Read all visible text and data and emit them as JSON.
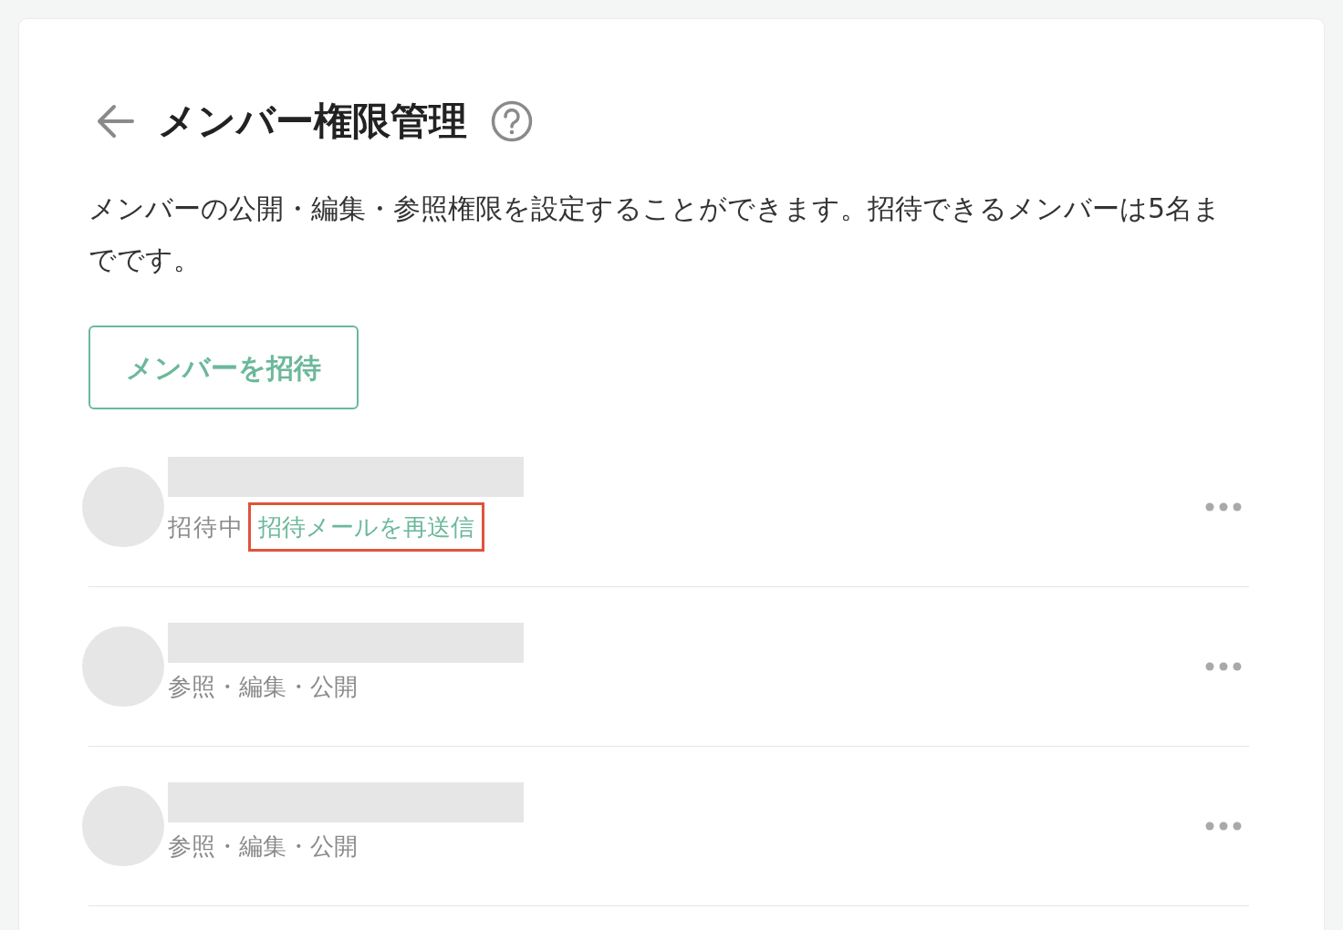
{
  "header": {
    "title": "メンバー権限管理"
  },
  "description": "メンバーの公開・編集・参照権限を設定することができます。招待できるメンバーは5名までです。",
  "invite_button": "メンバーを招待",
  "members": [
    {
      "kind": "invited",
      "status": "招待中",
      "action": "招待メールを再送信",
      "highlighted": true
    },
    {
      "kind": "member",
      "permissions": "参照・編集・公開"
    },
    {
      "kind": "member",
      "permissions": "参照・編集・公開"
    }
  ]
}
